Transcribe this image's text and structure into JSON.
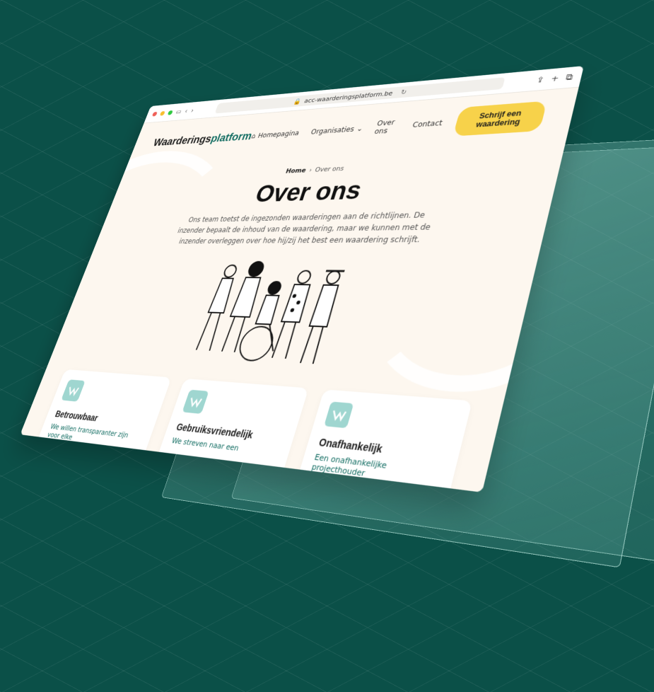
{
  "browser": {
    "url": "acc-waarderingsplatform.be"
  },
  "header": {
    "logo_main": "Waarderings",
    "logo_accent": "platform",
    "nav": {
      "home": "Homepagina",
      "organisations": "Organisaties",
      "about": "Over ons",
      "contact": "Contact"
    },
    "cta": "Schrijf een waardering"
  },
  "hero": {
    "breadcrumb_home": "Home",
    "breadcrumb_sep": "›",
    "breadcrumb_current": "Over ons",
    "title": "Over ons",
    "intro": "Ons team toetst de ingezonden waarderingen aan de richtlijnen. De inzender bepaalt de inhoud van de waardering, maar we kunnen met de inzender overleggen over hoe hij/zij het best een waardering schrijft."
  },
  "cards": [
    {
      "title": "Betrouwbaar",
      "text": "We willen transparanter zijn voor elke"
    },
    {
      "title": "Gebruiksvriendelijk",
      "text": "We streven naar een"
    },
    {
      "title": "Onafhankelijk",
      "text": "Een onafhankelijke projecthouder"
    }
  ],
  "colors": {
    "background": "#0b5048",
    "accent": "#0f6b60",
    "cta": "#f7d24a",
    "page": "#fdf7ef"
  }
}
